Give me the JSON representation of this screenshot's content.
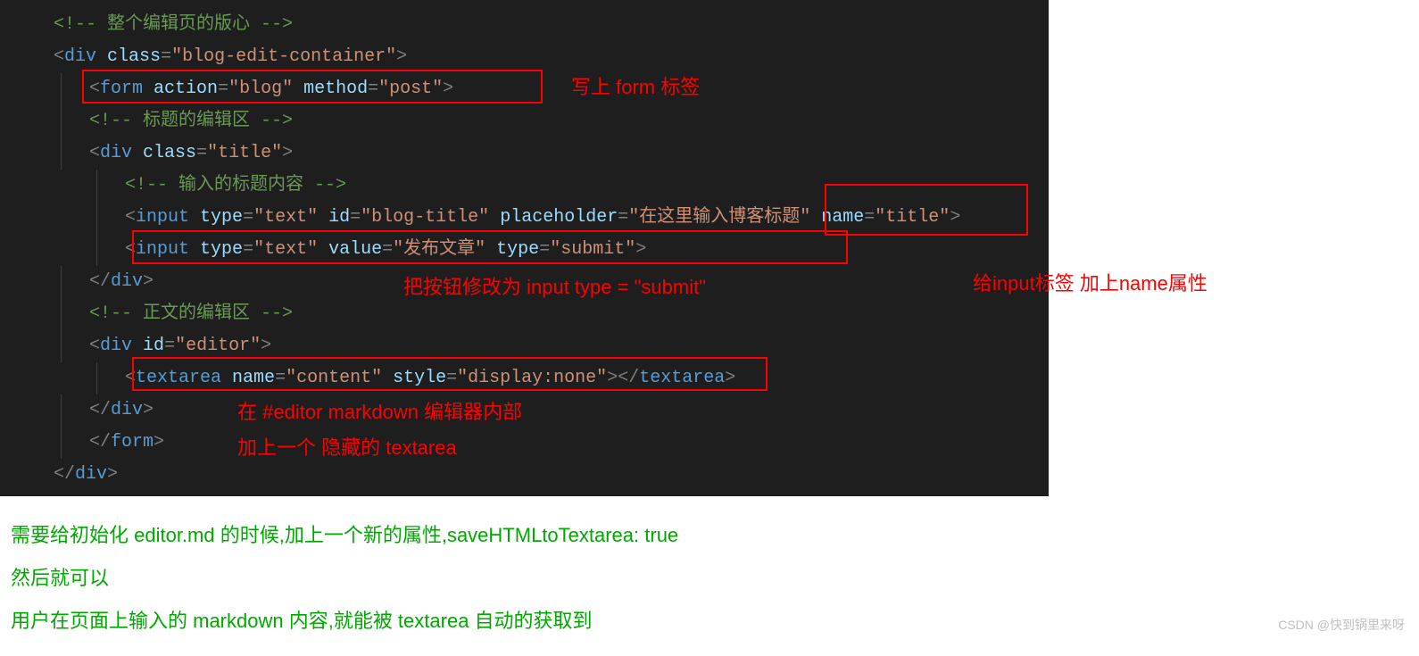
{
  "code": {
    "l1": {
      "c": "<!-- 整个编辑页的版心 -->"
    },
    "l2": {
      "p1": "<",
      "tag": "div",
      "sp": " ",
      "a1": "class",
      "eq": "=",
      "v1": "\"blog-edit-container\"",
      "p2": ">"
    },
    "l3": {
      "p1": "<",
      "tag": "form",
      "sp": " ",
      "a1": "action",
      "eq1": "=",
      "v1": "\"blog\"",
      "sp2": " ",
      "a2": "method",
      "eq2": "=",
      "v2": "\"post\"",
      "p2": ">"
    },
    "l4": {
      "c": "<!-- 标题的编辑区 -->"
    },
    "l5": {
      "p1": "<",
      "tag": "div",
      "sp": " ",
      "a1": "class",
      "eq": "=",
      "v1": "\"title\"",
      "p2": ">"
    },
    "l6": {
      "c": "<!-- 输入的标题内容 -->"
    },
    "l7": {
      "p1": "<",
      "tag": "input",
      "sp": " ",
      "a1": "type",
      "eq1": "=",
      "v1": "\"text\"",
      "sp2": " ",
      "a2": "id",
      "eq2": "=",
      "v2": "\"blog-title\"",
      "sp3": " ",
      "a3": "placeholder",
      "eq3": "=",
      "v3": "\"在这里输入博客标题\"",
      "sp4": " ",
      "a4": "name",
      "eq4": "=",
      "v4": "\"title\"",
      "p2": ">"
    },
    "l8": {
      "p1": "<",
      "tag": "input",
      "sp": " ",
      "a1": "type",
      "eq1": "=",
      "v1": "\"text\"",
      "sp2": " ",
      "a2": "value",
      "eq2": "=",
      "v2": "\"发布文章\"",
      "sp3": " ",
      "a3": "type",
      "eq3": "=",
      "v3": "\"submit\"",
      "p2": ">"
    },
    "l9": {
      "p1": "</",
      "tag": "div",
      "p2": ">"
    },
    "l10": {
      "c": "<!-- 正文的编辑区 -->"
    },
    "l11": {
      "p1": "<",
      "tag": "div",
      "sp": " ",
      "a1": "id",
      "eq": "=",
      "v1": "\"editor\"",
      "p2": ">"
    },
    "l12": {
      "p1": "<",
      "tag": "textarea",
      "sp": " ",
      "a1": "name",
      "eq1": "=",
      "v1": "\"content\"",
      "sp2": " ",
      "a2": "style",
      "eq2": "=",
      "v2": "\"display:none\"",
      "p2": "></",
      "tag2": "textarea",
      "p3": ">"
    },
    "l13": {
      "p1": "</",
      "tag": "div",
      "p2": ">"
    },
    "l14": {
      "p1": "</",
      "tag": "form",
      "p2": ">"
    },
    "l15": {
      "p1": "</",
      "tag": "div",
      "p2": ">"
    }
  },
  "annotations": {
    "a1": "写上 form 标签",
    "a2": "把按钮修改为 input type = \"submit\"",
    "a3": "给input标签 加上name属性",
    "a4": "在 #editor markdown 编辑器内部",
    "a5": "加上一个 隐藏的 textarea"
  },
  "notes": {
    "n1": "需要给初始化 editor.md 的时候,加上一个新的属性,saveHTMLtoTextarea: true",
    "n2": "然后就可以",
    "n3": "用户在页面上输入的 markdown 内容,就能被 textarea 自动的获取到"
  },
  "watermark": "CSDN @快到锅里来呀"
}
